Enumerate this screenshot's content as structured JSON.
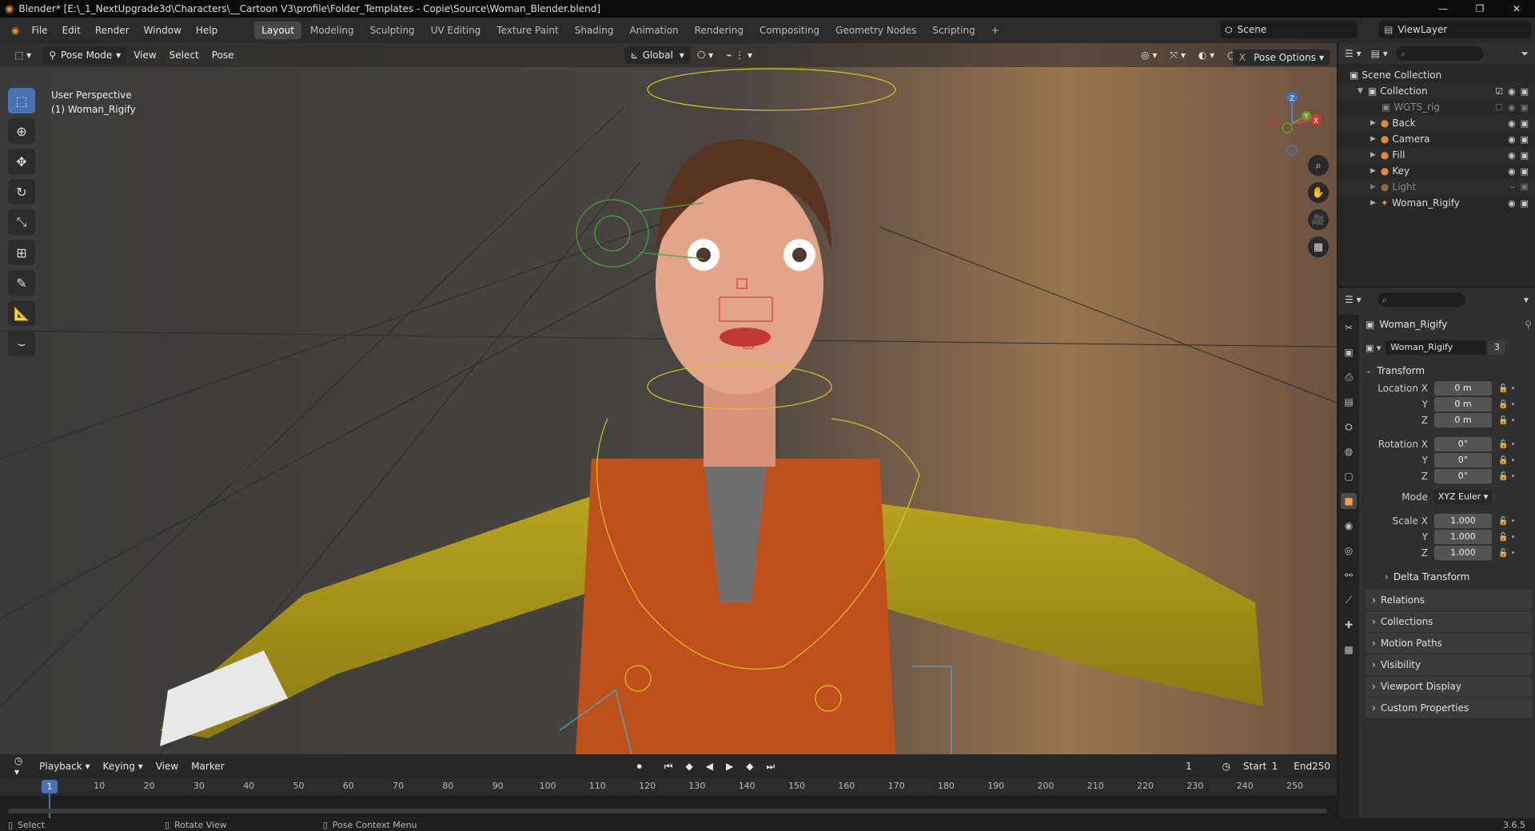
{
  "window": {
    "title": "Blender* [E:\\_1_NextUpgrade3d\\Characters\\__Cartoon V3\\profile\\Folder_Templates - Copie\\Source\\Woman_Blender.blend]",
    "controls": [
      "—",
      "❐",
      "✕"
    ]
  },
  "menu": {
    "items": [
      "File",
      "Edit",
      "Render",
      "Window",
      "Help"
    ],
    "workspaces": [
      "Layout",
      "Modeling",
      "Sculpting",
      "UV Editing",
      "Texture Paint",
      "Shading",
      "Animation",
      "Rendering",
      "Compositing",
      "Geometry Nodes",
      "Scripting"
    ],
    "active_workspace": "Layout",
    "add_workspace": "+",
    "scene": "Scene",
    "view_layer": "ViewLayer"
  },
  "viewport": {
    "mode": "Pose Mode",
    "menus": [
      "View",
      "Select",
      "Pose"
    ],
    "transform_orientation": "Global",
    "info_line1": "User Perspective",
    "info_line2": "(1) Woman_Rigify",
    "pose_options": "Pose Options",
    "x_mirror": "X",
    "gizmo_axes": [
      "X",
      "Y",
      "Z"
    ]
  },
  "outliner": {
    "root": "Scene Collection",
    "items": [
      {
        "name": "Collection",
        "indent": 1
      },
      {
        "name": "WGTS_rig",
        "indent": 2
      },
      {
        "name": "Back",
        "indent": 2
      },
      {
        "name": "Camera",
        "indent": 2
      },
      {
        "name": "Fill",
        "indent": 2
      },
      {
        "name": "Key",
        "indent": 2
      },
      {
        "name": "Light",
        "indent": 2
      },
      {
        "name": "Woman_Rigify",
        "indent": 2
      }
    ]
  },
  "properties": {
    "object_name": "Woman_Rigify",
    "datablock_name": "Woman_Rigify",
    "users": "3",
    "transform_title": "Transform",
    "location": {
      "label": "Location X",
      "x": "0 m",
      "y": "0 m",
      "z": "0 m"
    },
    "rotation": {
      "label": "Rotation X",
      "x": "0°",
      "y": "0°",
      "z": "0°"
    },
    "mode_label": "Mode",
    "mode_value": "XYZ Euler",
    "scale": {
      "label": "Scale X",
      "x": "1.000",
      "y": "1.000",
      "z": "1.000"
    },
    "axis_y": "Y",
    "axis_z": "Z",
    "delta_transform": "Delta Transform",
    "sections": [
      "Relations",
      "Collections",
      "Motion Paths",
      "Visibility",
      "Viewport Display",
      "Custom Properties"
    ]
  },
  "timeline": {
    "menus": [
      "Playback",
      "Keying",
      "View",
      "Marker"
    ],
    "current_frame": "1",
    "start_label": "Start",
    "start": "1",
    "end_label": "End",
    "end": "250",
    "ticks": [
      "10",
      "20",
      "30",
      "40",
      "50",
      "60",
      "70",
      "80",
      "90",
      "100",
      "110",
      "120",
      "130",
      "140",
      "150",
      "160",
      "170",
      "180",
      "190",
      "200",
      "210",
      "220",
      "230",
      "240",
      "250"
    ],
    "playhead": "1"
  },
  "status": {
    "select": "Select",
    "rotate": "Rotate View",
    "context": "Pose Context Menu",
    "version": "3.6.5"
  }
}
